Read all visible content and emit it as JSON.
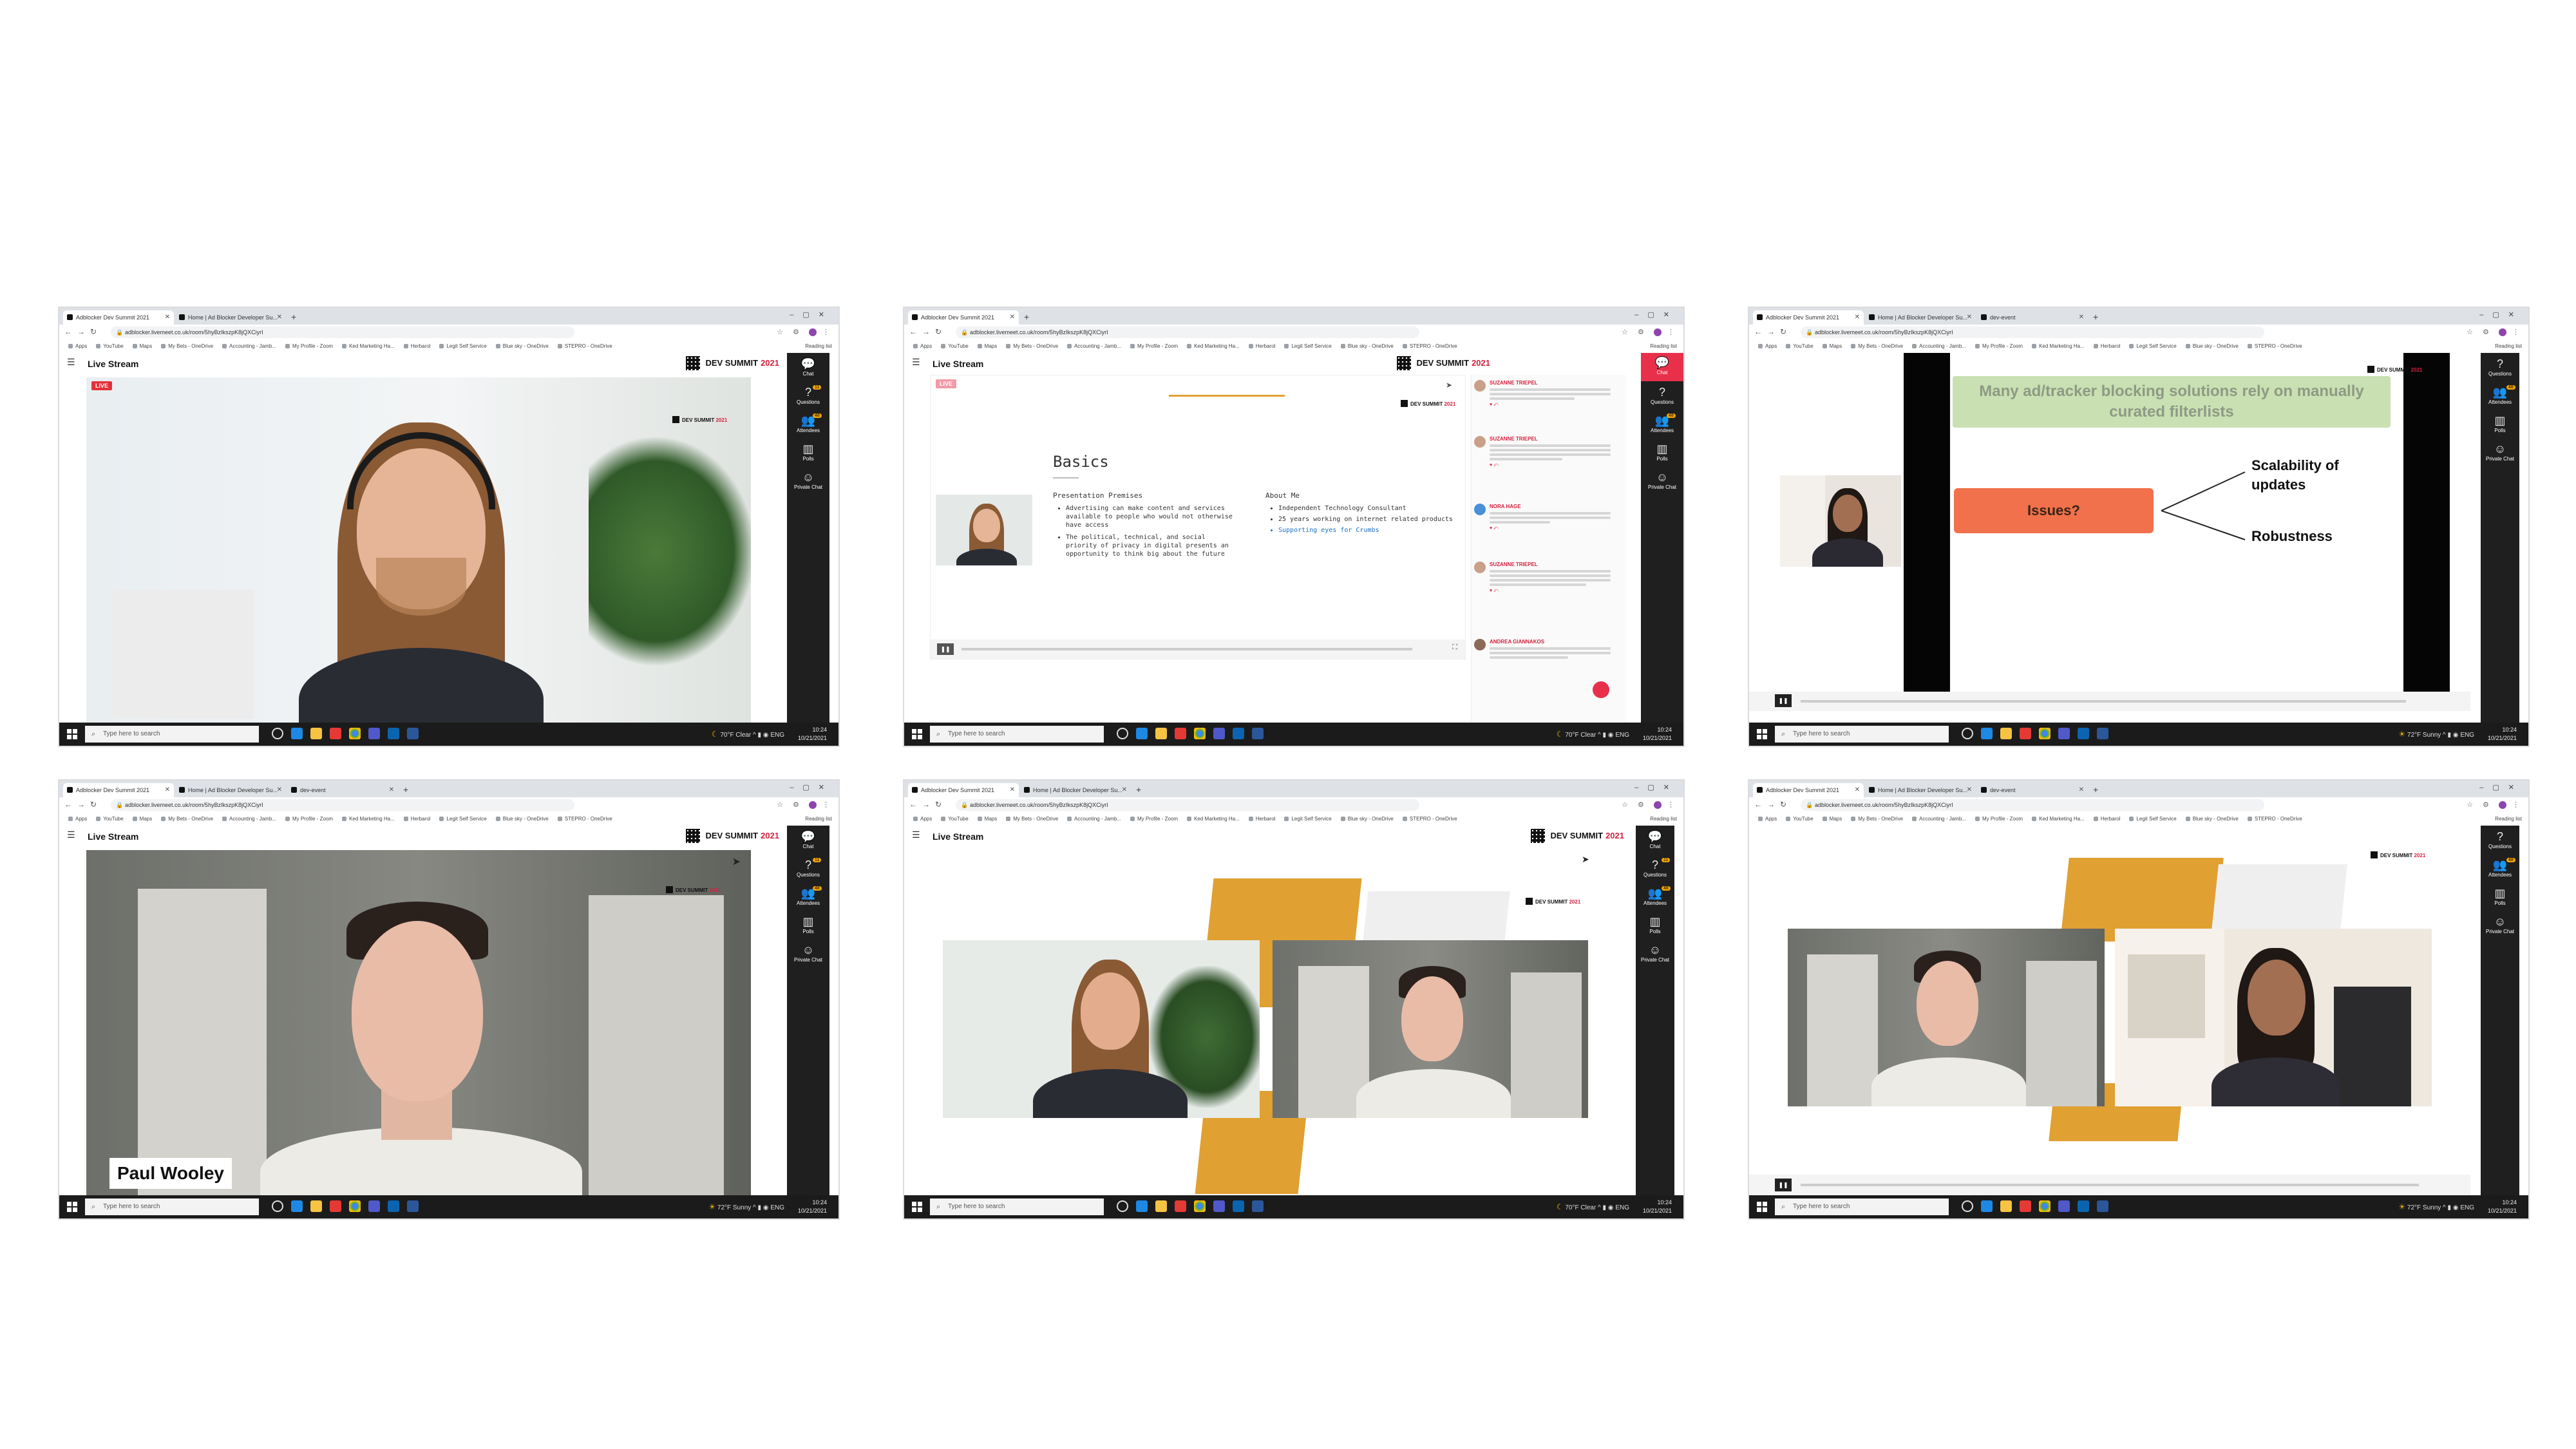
{
  "browser": {
    "tabs": [
      "Adblocker Dev Summit 2021",
      "Home | Ad Blocker Developer Su...",
      "dev-event"
    ],
    "url": "adblocker.livemeet.co.uk/room/5hyBzIkszpK8jQXCiyrI",
    "bookmarks": [
      "Apps",
      "YouTube",
      "Maps",
      "My Bets - OneDrive",
      "Accounting - Jamb...",
      "My Profile - Zoom",
      "Ked Marketing Ha...",
      "Herbarol",
      "Legit Self Service",
      "Blue sky - OneDrive",
      "STEPRO - OneDrive"
    ],
    "reading_list": "Reading list"
  },
  "app": {
    "title": "Live Stream",
    "brand": "DEV SUMMIT",
    "brand_year": "2021",
    "live_badge": "LIVE",
    "rail": [
      "Chat",
      "Questions",
      "Attendees",
      "Polls",
      "Private Chat"
    ]
  },
  "taskbar": {
    "search_placeholder": "Type here to search",
    "weather_clear": "70°F  Clear",
    "weather_sunny": "72°F  Sunny",
    "time": "10:24",
    "date": "10/21/2021"
  },
  "slide_basics": {
    "title": "Basics",
    "col1_heading": "Presentation Premises",
    "col1_items": [
      "Advertising can make content and services available to people who would not otherwise have access",
      "The political, technical, and social priority of privacy in digital presents an opportunity to think big about the future"
    ],
    "col2_heading": "About Me",
    "col2_items": [
      "Independent Technology Consultant",
      "25 years working on internet related products",
      "Supporting eyes for Crumbs"
    ]
  },
  "chat": [
    {
      "name": "SUZANNE TRIEPEL"
    },
    {
      "name": "SUZANNE TRIEPEL"
    },
    {
      "name": "NORA HAGE"
    },
    {
      "name": "SUZANNE TRIEPEL"
    },
    {
      "name": "ANDREA GIANNAKOS"
    }
  ],
  "slide_issues": {
    "headline": "Many ad/tracker blocking solutions rely on manually curated filterlists",
    "box": "Issues?",
    "point1": "Scalability of updates",
    "point2": "Robustness"
  },
  "speaker_name": "Paul Wooley",
  "colors": {
    "live_red": "#e3323a",
    "brand_red": "#d4213d",
    "accent_orange": "#e0a032",
    "slide_green": "#c9e0b2",
    "issues_orange": "#f0714b"
  }
}
